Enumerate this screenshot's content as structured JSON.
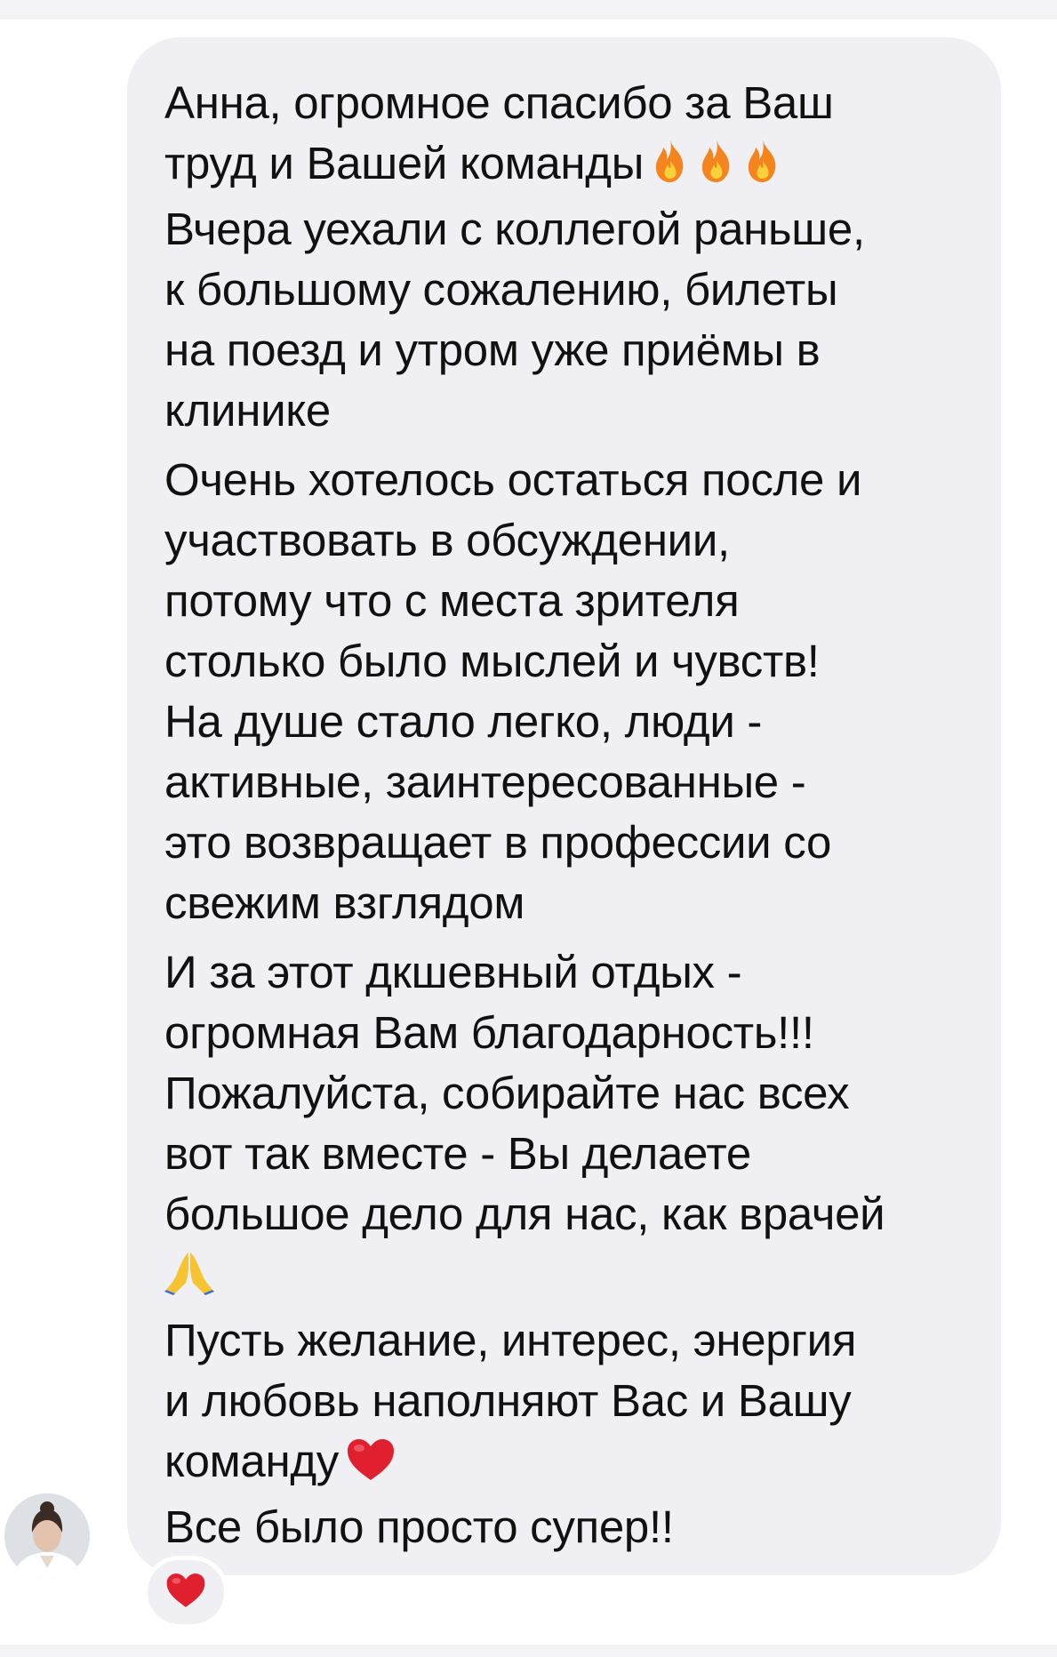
{
  "message": {
    "lines": [
      "Анна, огромное спасибо за Ваш",
      "труд и Вашей команды",
      "Вчера уехали с коллегой раньше,",
      "к большому сожалению, билеты",
      "на поезд и утром уже приёмы в",
      "клинике",
      "Очень хотелось остаться после и",
      "участвовать в обсуждении,",
      "потому что с места зрителя",
      "столько было мыслей и чувств!",
      "На душе стало легко, люди -",
      "активные, заинтересованные -",
      "это возвращает в профессии со",
      "свежим взглядом",
      "И за этот дкшевный отдых -",
      "огромная Вам благодарность!!!",
      "Пожалуйста, собирайте нас всех",
      "вот так вместе - Вы делаете",
      "большое дело для нас, как врачей",
      "",
      "Пусть желание, интерес, энергия",
      "и любовь наполняют Вас и Вашу",
      "команду",
      "Все было просто супер!!"
    ],
    "emojis": {
      "line_2": [
        "fire-icon",
        "fire-icon",
        "fire-icon"
      ],
      "line_20": [
        "praying-hands-icon"
      ],
      "line_23": [
        "heart-icon"
      ]
    }
  },
  "reaction": {
    "icon": "heart-icon",
    "color": "#e0202e"
  },
  "sender": {
    "avatar": "avatar"
  },
  "colors": {
    "bubble": "#efeff4",
    "text": "#111111",
    "fire": "#f5841f",
    "heart": "#e0202e",
    "hands": "#f6c432"
  }
}
